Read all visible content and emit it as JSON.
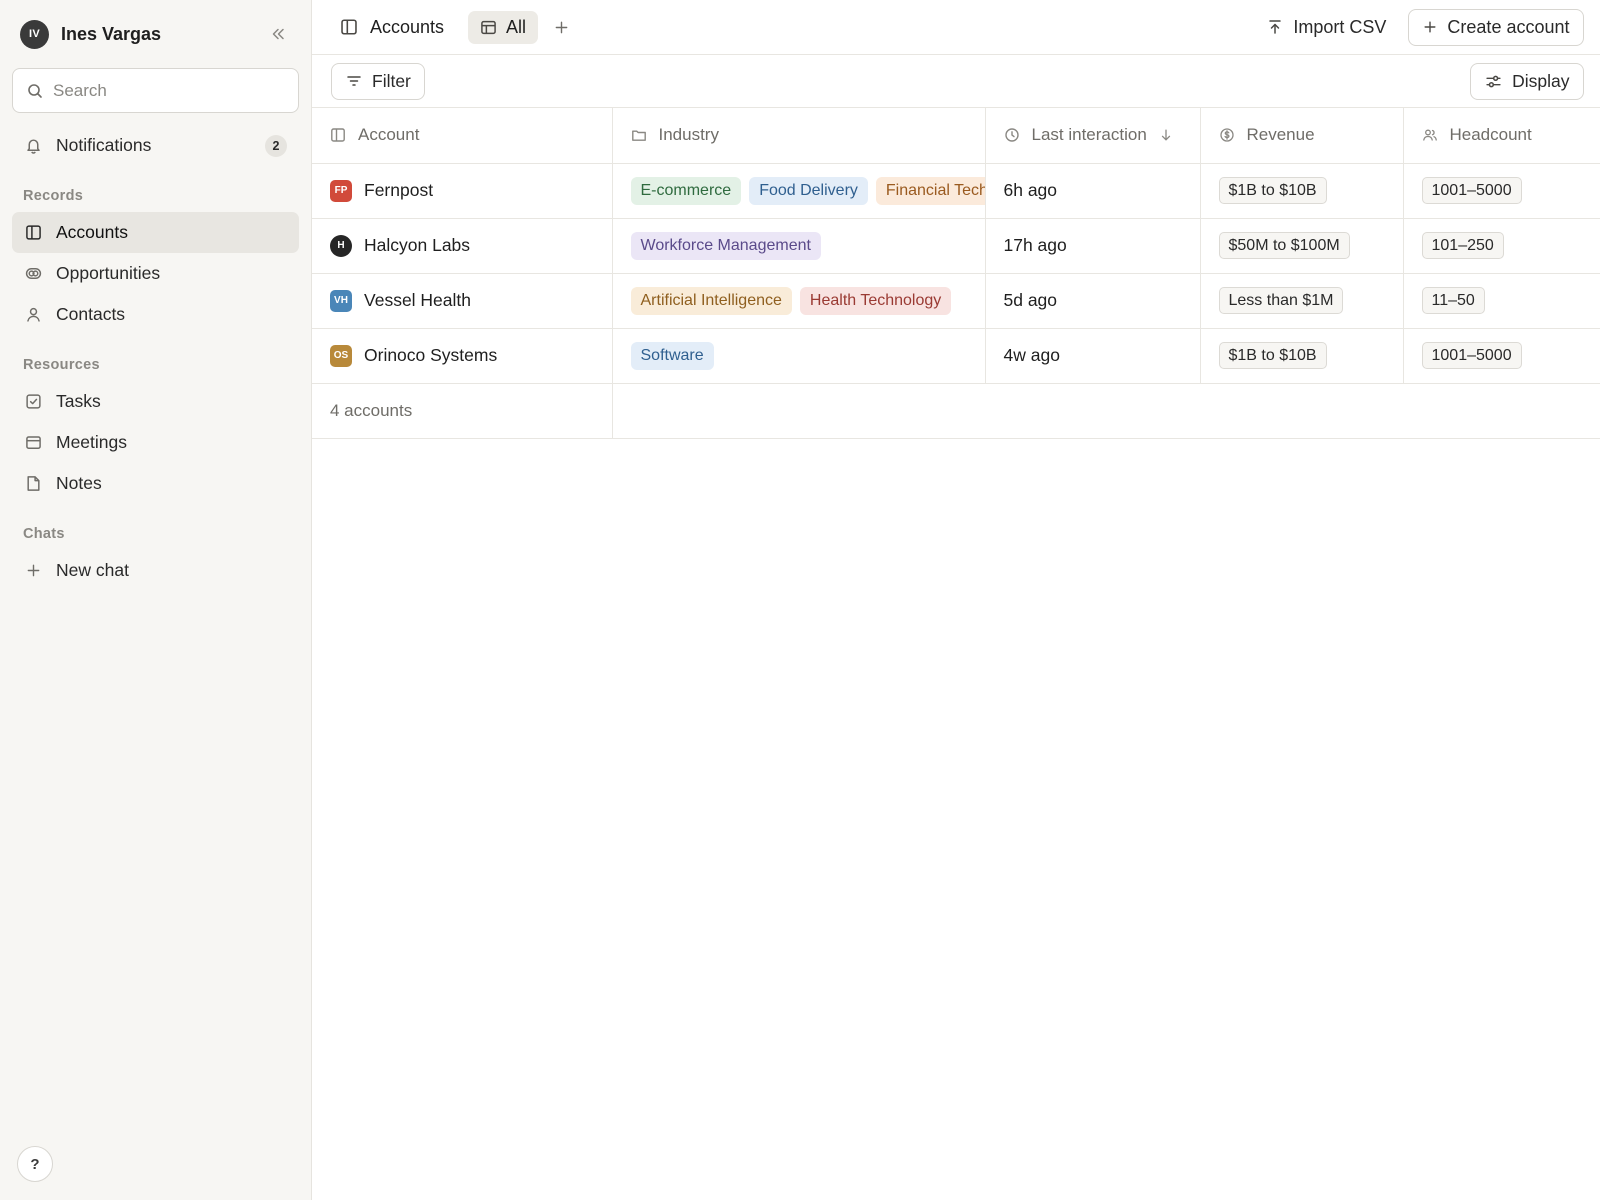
{
  "sidebar": {
    "user": {
      "initials": "IV",
      "name": "Ines Vargas"
    },
    "search": {
      "placeholder": "Search",
      "value": ""
    },
    "notifications": {
      "label": "Notifications",
      "count": "2"
    },
    "records_label": "Records",
    "records": [
      {
        "label": "Accounts",
        "icon": "columns-icon",
        "active": true
      },
      {
        "label": "Opportunities",
        "icon": "rings-icon"
      },
      {
        "label": "Contacts",
        "icon": "person-icon"
      }
    ],
    "resources_label": "Resources",
    "resources": [
      {
        "label": "Tasks",
        "icon": "checkbox-icon"
      },
      {
        "label": "Meetings",
        "icon": "calendar-icon"
      },
      {
        "label": "Notes",
        "icon": "note-icon"
      }
    ],
    "chats_label": "Chats",
    "new_chat": "New chat",
    "help": "?"
  },
  "topbar": {
    "title": "Accounts",
    "view_tab": "All",
    "import_label": "Import CSV",
    "create_label": "Create account"
  },
  "toolbar": {
    "filter_label": "Filter",
    "display_label": "Display"
  },
  "table": {
    "columns": [
      {
        "label": "Account",
        "icon": "columns-icon"
      },
      {
        "label": "Industry",
        "icon": "folder-icon"
      },
      {
        "label": "Last interaction",
        "icon": "clock-icon",
        "sort": "desc"
      },
      {
        "label": "Revenue",
        "icon": "dollar-icon"
      },
      {
        "label": "Headcount",
        "icon": "people-icon"
      }
    ],
    "rows": [
      {
        "logo": "FP",
        "logo_color": "#d14a3a",
        "name": "Fernpost",
        "industries": [
          "E-commerce",
          "Food Delivery",
          "Financial Technology"
        ],
        "last_interaction": "6h ago",
        "revenue": "$1B to $10B",
        "headcount": "1001–5000"
      },
      {
        "logo": "H",
        "logo_color": "#262626",
        "name": "Halcyon Labs",
        "industries": [
          "Workforce Management"
        ],
        "last_interaction": "17h ago",
        "revenue": "$50M to $100M",
        "headcount": "101–250"
      },
      {
        "logo": "VH",
        "logo_color": "#4a86b8",
        "name": "Vessel Health",
        "industries": [
          "Artificial Intelligence",
          "Health Technology"
        ],
        "last_interaction": "5d ago",
        "revenue": "Less than $1M",
        "headcount": "11–50"
      },
      {
        "logo": "OS",
        "logo_color": "#b8893a",
        "name": "Orinoco Systems",
        "industries": [
          "Software"
        ],
        "last_interaction": "4w ago",
        "revenue": "$1B to $10B",
        "headcount": "1001–5000"
      }
    ],
    "footer": "4 accounts"
  },
  "tag_colors": {
    "E-commerce": {
      "bg": "#e3f1e6",
      "fg": "#2f6b3f"
    },
    "Food Delivery": {
      "bg": "#e3edf8",
      "fg": "#2f5f8f"
    },
    "Financial Technology": {
      "bg": "#fbeadb",
      "fg": "#9a5a1f"
    },
    "Workforce Management": {
      "bg": "#ebe6f6",
      "fg": "#5a4a8a"
    },
    "Artificial Intelligence": {
      "bg": "#f9ecd9",
      "fg": "#8f5f1f"
    },
    "Health Technology": {
      "bg": "#f8e3e1",
      "fg": "#9a3a33"
    },
    "Software": {
      "bg": "#e3edf8",
      "fg": "#2f5f8f"
    }
  }
}
